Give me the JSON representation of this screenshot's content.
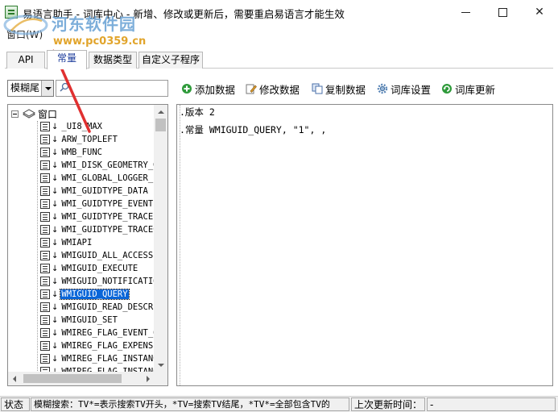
{
  "window": {
    "title": "易语言助手 - 词库中心 - 新增、修改或更新后，需要重启易语言才能生效",
    "icon": "app-icon"
  },
  "watermark": {
    "site_name": "河东软件园",
    "url": "www.pc0359.cn"
  },
  "menu": {
    "item": "窗口(W)"
  },
  "tabs": [
    {
      "label": "API",
      "active": false
    },
    {
      "label": "常量",
      "active": true
    },
    {
      "label": "数据类型",
      "active": false
    },
    {
      "label": "自定义子程序",
      "active": false
    }
  ],
  "search": {
    "mode": "模糊尾",
    "value": "",
    "placeholder": ""
  },
  "toolbar": {
    "add": "添加数据",
    "edit": "修改数据",
    "copy": "复制数据",
    "settings": "词库设置",
    "update": "词库更新"
  },
  "tree": {
    "root": "窗口",
    "selected_index": 14,
    "items": [
      "_UI8_MAX",
      "ARW_TOPLEFT",
      "WMB_FUNC",
      "WMI_DISK_GEOMETRY_GUI",
      "WMI_GLOBAL_LOGGER_ID",
      "WMI_GUIDTYPE_DATA",
      "WMI_GUIDTYPE_EVENT",
      "WMI_GUIDTYPE_TRACE",
      "WMI_GUIDTYPE_TRACECO",
      "WMIAPI",
      "WMIGUID_ALL_ACCESS",
      "WMIGUID_EXECUTE",
      "WMIGUID_NOTIFICATION",
      "WMIGUID_QUERY",
      "WMIGUID_READ_DESCRIPT",
      "WMIGUID_SET",
      "WMIREG_FLAG_EVENT_ON",
      "WMIREG_FLAG_EXPENSIV",
      "WMIREG_FLAG_INSTANCE",
      "WMIREG_FLAG_INSTANCE"
    ]
  },
  "editor": {
    "lines": [
      ".版本 2",
      ".常量 WMIGUID_QUERY, \"1\", ,"
    ]
  },
  "statusbar": {
    "status_label": "状态",
    "hint": "模糊搜索：TV*=表示搜索TV开头，*TV=搜索TV结尾，*TV*=全部包含TV的",
    "last_update_label": "上次更新时间：",
    "last_update_value": "-"
  },
  "colors": {
    "selection": "#0a66d8",
    "active_tab_text": "#1a3a9a",
    "arrow": "#e03030"
  }
}
